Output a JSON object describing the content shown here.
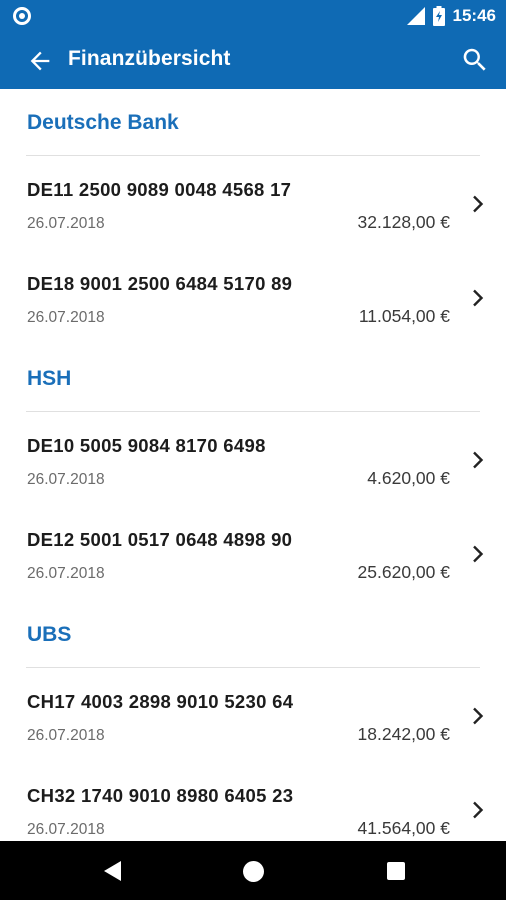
{
  "status_bar": {
    "time": "15:46"
  },
  "app_bar": {
    "title": "Finanzübersicht"
  },
  "groups": [
    {
      "name": "Deutsche Bank",
      "accounts": [
        {
          "iban": "DE11 2500 9089 0048 4568 17",
          "date": "26.07.2018",
          "balance": "32.128,00 €"
        },
        {
          "iban": "DE18 9001 2500 6484 5170 89",
          "date": "26.07.2018",
          "balance": "11.054,00 €"
        }
      ]
    },
    {
      "name": "HSH",
      "accounts": [
        {
          "iban": "DE10 5005 9084 8170 6498",
          "date": "26.07.2018",
          "balance": "4.620,00 €"
        },
        {
          "iban": "DE12 5001 0517 0648 4898 90",
          "date": "26.07.2018",
          "balance": "25.620,00 €"
        }
      ]
    },
    {
      "name": "UBS",
      "accounts": [
        {
          "iban": "CH17 4003 2898 9010 5230 64",
          "date": "26.07.2018",
          "balance": "18.242,00 €"
        },
        {
          "iban": "CH32 1740 9010 8980 6405 23",
          "date": "26.07.2018",
          "balance": "41.564,00 €"
        }
      ]
    }
  ],
  "colors": {
    "primary": "#0f6ab4",
    "group_header": "#1a6fb9",
    "navbar": "#000000"
  },
  "icons": {
    "status": [
      "notification-dot-icon",
      "signal-icon",
      "battery-icon"
    ],
    "app_bar": [
      "back-arrow-icon",
      "search-icon"
    ],
    "row": "chevron-right-icon",
    "navbar": [
      "nav-back-icon",
      "nav-home-icon",
      "nav-recents-icon"
    ]
  }
}
